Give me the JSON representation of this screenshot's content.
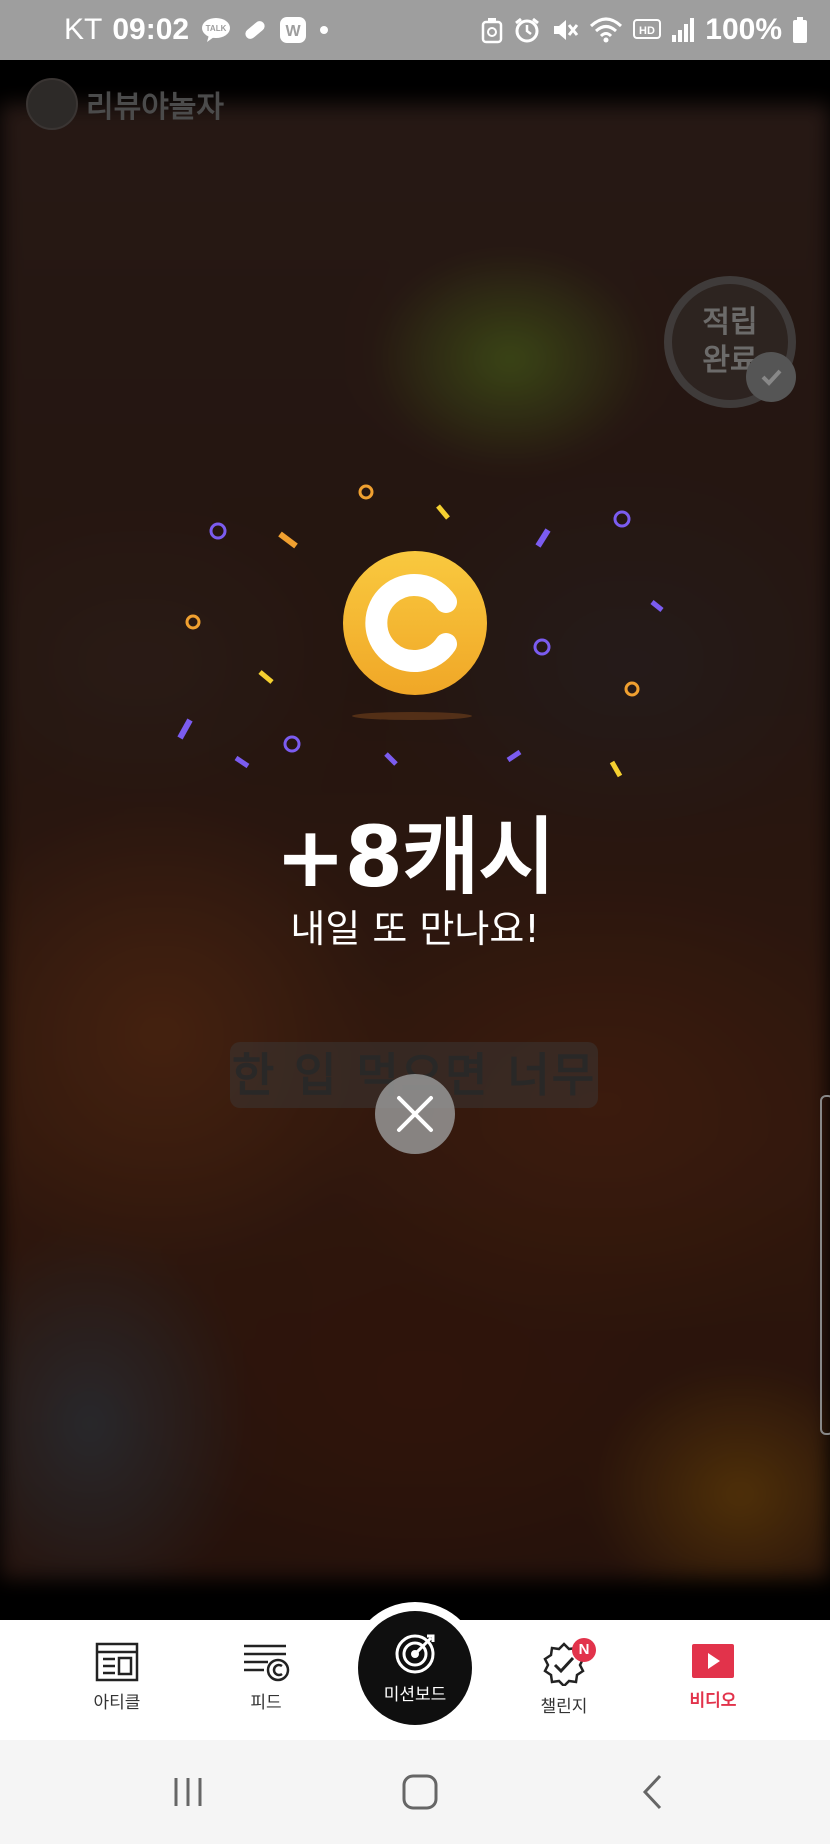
{
  "status_bar": {
    "carrier": "KT",
    "time": "09:02",
    "battery": "100%",
    "notification_icons": [
      "talk-icon",
      "pill-icon",
      "w-app-icon",
      "dot-icon"
    ],
    "system_icons": [
      "recycle-icon",
      "alarm-icon",
      "mute-icon",
      "wifi-icon",
      "hd-icon",
      "signal-icon",
      "battery-icon"
    ],
    "talk_text": "TALK",
    "w_text": "W",
    "hd_text": "HD"
  },
  "video": {
    "channel_name": "리뷰야놀자",
    "badge_text_line1": "적립",
    "badge_text_line2": "완료",
    "subtitle": "한 입 먹으면 너무"
  },
  "reward": {
    "coin_letter": "C",
    "amount": "+8캐시",
    "message": "내일 또 만나요!"
  },
  "bottom_nav": {
    "items": [
      {
        "label": "아티클",
        "icon": "article-icon"
      },
      {
        "label": "피드",
        "icon": "feed-icon"
      },
      {
        "label": "미션보드",
        "icon": "target-icon"
      },
      {
        "label": "챌린지",
        "icon": "challenge-badge-icon"
      },
      {
        "label": "비디오",
        "icon": "video-play-icon"
      }
    ],
    "new_badge": "N",
    "active_color": "#e2334b"
  },
  "system_nav": {
    "buttons": [
      "recent-apps-icon",
      "home-icon",
      "back-icon"
    ]
  },
  "colors": {
    "coin": "#f5b731",
    "confetti_orange": "#f0a030",
    "confetti_purple": "#7b5cf0",
    "confetti_yellow": "#f5d030"
  }
}
